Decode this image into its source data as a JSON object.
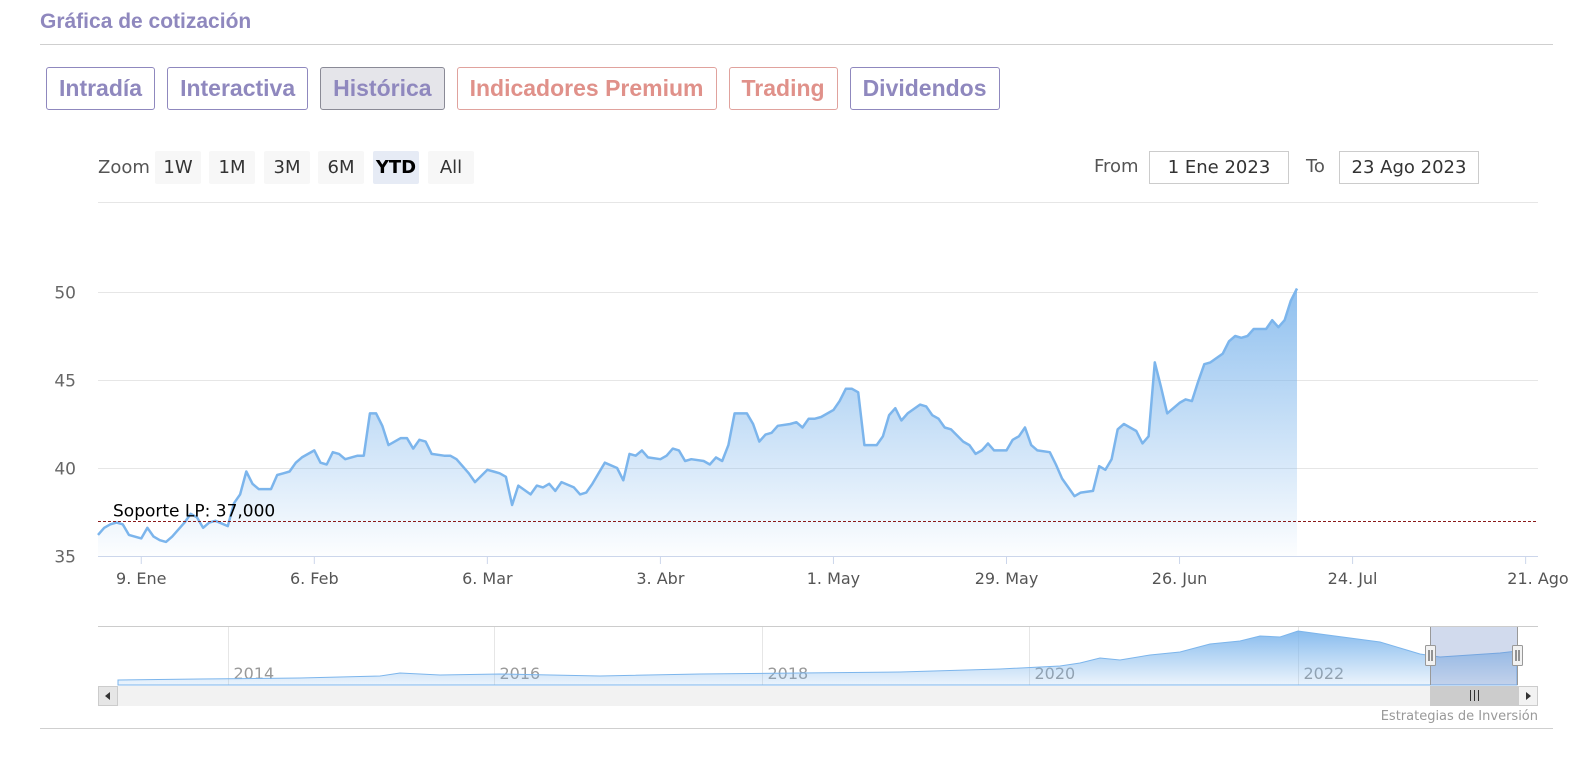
{
  "page": {
    "title": "Gráfica de cotización",
    "credit": "Estrategias de Inversión"
  },
  "tabs": [
    {
      "label": "Intradía",
      "active": false,
      "premium": false
    },
    {
      "label": "Interactiva",
      "active": false,
      "premium": false
    },
    {
      "label": "Histórica",
      "active": true,
      "premium": false
    },
    {
      "label": "Indicadores Premium",
      "active": false,
      "premium": true
    },
    {
      "label": "Trading",
      "active": false,
      "premium": true
    },
    {
      "label": "Dividendos",
      "active": false,
      "premium": false
    }
  ],
  "zoom": {
    "label": "Zoom",
    "buttons": [
      "1W",
      "1M",
      "3M",
      "6M",
      "YTD",
      "All"
    ],
    "selected": "YTD"
  },
  "range": {
    "from_label": "From",
    "from_value": "1 Ene 2023",
    "to_label": "To",
    "to_value": "23 Ago 2023"
  },
  "colors": {
    "series": "#7cb5ec",
    "plotline": "#8b1a1a",
    "tab": "#8f88be",
    "tab_premium": "#e0918a"
  },
  "chart_data": {
    "type": "area",
    "ylim": [
      35,
      50
    ],
    "yticks": [
      35,
      40,
      45,
      50
    ],
    "grid": true,
    "x_start_date": "2023-01-02",
    "x_end_date": "2023-08-23",
    "xticks": [
      {
        "date": "2023-01-09",
        "label": "9. Ene"
      },
      {
        "date": "2023-02-06",
        "label": "6. Feb"
      },
      {
        "date": "2023-03-06",
        "label": "6. Mar"
      },
      {
        "date": "2023-04-03",
        "label": "3. Abr"
      },
      {
        "date": "2023-05-01",
        "label": "1. May"
      },
      {
        "date": "2023-05-29",
        "label": "29. May"
      },
      {
        "date": "2023-06-26",
        "label": "26. Jun"
      },
      {
        "date": "2023-07-24",
        "label": "24. Jul"
      },
      {
        "date": "2023-08-21",
        "label": "21. Ago"
      }
    ],
    "series": [
      {
        "points": [
          [
            "2023-01-02",
            36.2
          ],
          [
            "2023-01-03",
            36.6
          ],
          [
            "2023-01-04",
            36.8
          ],
          [
            "2023-01-05",
            36.9
          ],
          [
            "2023-01-06",
            36.8
          ],
          [
            "2023-01-07",
            36.2
          ],
          [
            "2023-01-09",
            36.0
          ],
          [
            "2023-01-10",
            36.6
          ],
          [
            "2023-01-11",
            36.1
          ],
          [
            "2023-01-12",
            35.9
          ],
          [
            "2023-01-13",
            35.8
          ],
          [
            "2023-01-14",
            36.1
          ],
          [
            "2023-01-16",
            36.9
          ],
          [
            "2023-01-17",
            37.4
          ],
          [
            "2023-01-18",
            37.2
          ],
          [
            "2023-01-19",
            36.6
          ],
          [
            "2023-01-20",
            36.9
          ],
          [
            "2023-01-21",
            37.0
          ],
          [
            "2023-01-23",
            36.7
          ],
          [
            "2023-01-24",
            38.0
          ],
          [
            "2023-01-25",
            38.5
          ],
          [
            "2023-01-26",
            39.8
          ],
          [
            "2023-01-27",
            39.1
          ],
          [
            "2023-01-28",
            38.8
          ],
          [
            "2023-01-30",
            38.8
          ],
          [
            "2023-01-31",
            39.6
          ],
          [
            "2023-02-01",
            39.7
          ],
          [
            "2023-02-02",
            39.8
          ],
          [
            "2023-02-03",
            40.3
          ],
          [
            "2023-02-04",
            40.6
          ],
          [
            "2023-02-06",
            41.0
          ],
          [
            "2023-02-07",
            40.3
          ],
          [
            "2023-02-08",
            40.2
          ],
          [
            "2023-02-09",
            40.9
          ],
          [
            "2023-02-10",
            40.8
          ],
          [
            "2023-02-11",
            40.5
          ],
          [
            "2023-02-13",
            40.7
          ],
          [
            "2023-02-14",
            40.7
          ],
          [
            "2023-02-15",
            43.1
          ],
          [
            "2023-02-16",
            43.1
          ],
          [
            "2023-02-17",
            42.4
          ],
          [
            "2023-02-18",
            41.3
          ],
          [
            "2023-02-20",
            41.7
          ],
          [
            "2023-02-21",
            41.7
          ],
          [
            "2023-02-22",
            41.1
          ],
          [
            "2023-02-23",
            41.6
          ],
          [
            "2023-02-24",
            41.5
          ],
          [
            "2023-02-25",
            40.8
          ],
          [
            "2023-02-27",
            40.7
          ],
          [
            "2023-02-28",
            40.7
          ],
          [
            "2023-03-01",
            40.5
          ],
          [
            "2023-03-02",
            40.1
          ],
          [
            "2023-03-03",
            39.7
          ],
          [
            "2023-03-04",
            39.2
          ],
          [
            "2023-03-06",
            39.9
          ],
          [
            "2023-03-07",
            39.8
          ],
          [
            "2023-03-08",
            39.7
          ],
          [
            "2023-03-09",
            39.5
          ],
          [
            "2023-03-10",
            37.9
          ],
          [
            "2023-03-11",
            39.0
          ],
          [
            "2023-03-13",
            38.5
          ],
          [
            "2023-03-14",
            39.0
          ],
          [
            "2023-03-15",
            38.9
          ],
          [
            "2023-03-16",
            39.1
          ],
          [
            "2023-03-17",
            38.7
          ],
          [
            "2023-03-18",
            39.2
          ],
          [
            "2023-03-20",
            38.9
          ],
          [
            "2023-03-21",
            38.5
          ],
          [
            "2023-03-22",
            38.6
          ],
          [
            "2023-03-23",
            39.1
          ],
          [
            "2023-03-24",
            39.7
          ],
          [
            "2023-03-25",
            40.3
          ],
          [
            "2023-03-27",
            40.0
          ],
          [
            "2023-03-28",
            39.3
          ],
          [
            "2023-03-29",
            40.8
          ],
          [
            "2023-03-30",
            40.7
          ],
          [
            "2023-03-31",
            41.0
          ],
          [
            "2023-04-01",
            40.6
          ],
          [
            "2023-04-03",
            40.5
          ],
          [
            "2023-04-04",
            40.7
          ],
          [
            "2023-04-05",
            41.1
          ],
          [
            "2023-04-06",
            41.0
          ],
          [
            "2023-04-07",
            40.4
          ],
          [
            "2023-04-08",
            40.5
          ],
          [
            "2023-04-10",
            40.4
          ],
          [
            "2023-04-11",
            40.2
          ],
          [
            "2023-04-12",
            40.6
          ],
          [
            "2023-04-13",
            40.4
          ],
          [
            "2023-04-14",
            41.3
          ],
          [
            "2023-04-15",
            43.1
          ],
          [
            "2023-04-17",
            43.1
          ],
          [
            "2023-04-18",
            42.5
          ],
          [
            "2023-04-19",
            41.5
          ],
          [
            "2023-04-20",
            41.9
          ],
          [
            "2023-04-21",
            42.0
          ],
          [
            "2023-04-22",
            42.4
          ],
          [
            "2023-04-24",
            42.5
          ],
          [
            "2023-04-25",
            42.6
          ],
          [
            "2023-04-26",
            42.3
          ],
          [
            "2023-04-27",
            42.8
          ],
          [
            "2023-04-28",
            42.8
          ],
          [
            "2023-04-29",
            42.9
          ],
          [
            "2023-05-01",
            43.3
          ],
          [
            "2023-05-02",
            43.8
          ],
          [
            "2023-05-03",
            44.5
          ],
          [
            "2023-05-04",
            44.5
          ],
          [
            "2023-05-05",
            44.3
          ],
          [
            "2023-05-06",
            41.3
          ],
          [
            "2023-05-08",
            41.3
          ],
          [
            "2023-05-09",
            41.8
          ],
          [
            "2023-05-10",
            43.0
          ],
          [
            "2023-05-11",
            43.4
          ],
          [
            "2023-05-12",
            42.7
          ],
          [
            "2023-05-13",
            43.1
          ],
          [
            "2023-05-15",
            43.6
          ],
          [
            "2023-05-16",
            43.5
          ],
          [
            "2023-05-17",
            43.0
          ],
          [
            "2023-05-18",
            42.8
          ],
          [
            "2023-05-19",
            42.3
          ],
          [
            "2023-05-20",
            42.2
          ],
          [
            "2023-05-22",
            41.5
          ],
          [
            "2023-05-23",
            41.3
          ],
          [
            "2023-05-24",
            40.8
          ],
          [
            "2023-05-25",
            41.0
          ],
          [
            "2023-05-26",
            41.4
          ],
          [
            "2023-05-27",
            41.0
          ],
          [
            "2023-05-29",
            41.0
          ],
          [
            "2023-05-30",
            41.6
          ],
          [
            "2023-05-31",
            41.8
          ],
          [
            "2023-06-01",
            42.3
          ],
          [
            "2023-06-02",
            41.3
          ],
          [
            "2023-06-03",
            41.0
          ],
          [
            "2023-06-05",
            40.9
          ],
          [
            "2023-06-06",
            40.2
          ],
          [
            "2023-06-07",
            39.4
          ],
          [
            "2023-06-08",
            38.9
          ],
          [
            "2023-06-09",
            38.4
          ],
          [
            "2023-06-10",
            38.6
          ],
          [
            "2023-06-12",
            38.7
          ],
          [
            "2023-06-13",
            40.1
          ],
          [
            "2023-06-14",
            39.9
          ],
          [
            "2023-06-15",
            40.5
          ],
          [
            "2023-06-16",
            42.2
          ],
          [
            "2023-06-17",
            42.5
          ],
          [
            "2023-06-19",
            42.1
          ],
          [
            "2023-06-20",
            41.4
          ],
          [
            "2023-06-21",
            41.8
          ],
          [
            "2023-06-22",
            46.0
          ],
          [
            "2023-06-23",
            44.6
          ],
          [
            "2023-06-24",
            43.1
          ],
          [
            "2023-06-26",
            43.7
          ],
          [
            "2023-06-27",
            43.9
          ],
          [
            "2023-06-28",
            43.8
          ],
          [
            "2023-06-29",
            44.9
          ],
          [
            "2023-06-30",
            45.9
          ],
          [
            "2023-07-01",
            46.0
          ],
          [
            "2023-07-03",
            46.5
          ],
          [
            "2023-07-04",
            47.2
          ],
          [
            "2023-07-05",
            47.5
          ],
          [
            "2023-07-06",
            47.4
          ],
          [
            "2023-07-07",
            47.5
          ],
          [
            "2023-07-08",
            47.9
          ],
          [
            "2023-07-10",
            47.9
          ],
          [
            "2023-07-11",
            48.4
          ],
          [
            "2023-07-12",
            48.0
          ],
          [
            "2023-07-13",
            48.4
          ],
          [
            "2023-07-14",
            49.5
          ],
          [
            "2023-07-15",
            50.2
          ]
        ]
      }
    ],
    "plotlines": [
      {
        "value": 37.0,
        "label": "Soporte LP: 37,000",
        "style": "dashed"
      }
    ],
    "navigator": {
      "xticks": [
        "2014",
        "2016",
        "2018",
        "2020",
        "2022"
      ]
    }
  }
}
